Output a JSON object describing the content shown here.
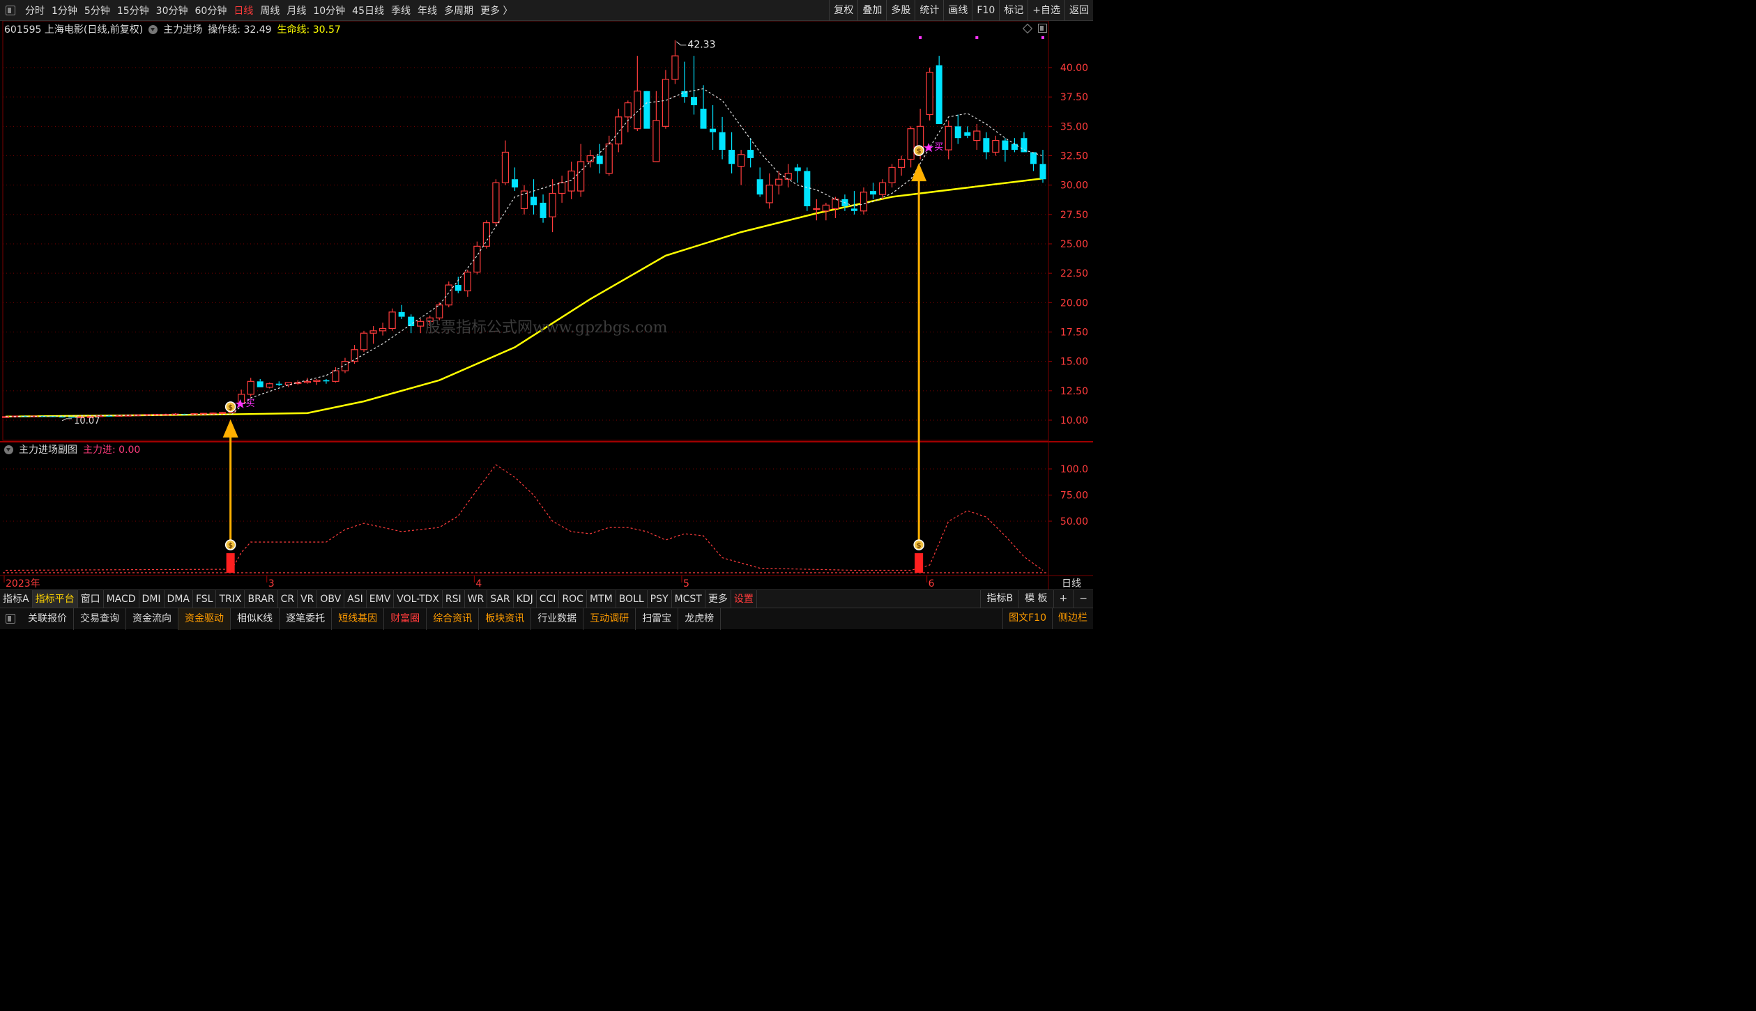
{
  "topbar": {
    "periods": [
      "分时",
      "1分钟",
      "5分钟",
      "15分钟",
      "30分钟",
      "60分钟",
      "日线",
      "周线",
      "月线",
      "10分钟",
      "45日线",
      "季线",
      "年线",
      "多周期",
      "更多 〉"
    ],
    "active_period": "日线",
    "tools": [
      "复权",
      "叠加",
      "多股",
      "统计",
      "画线",
      "F10",
      "标记",
      "+自选",
      "返回"
    ]
  },
  "header": {
    "stock": "601595 上海电影(日线,前复权)",
    "indicator": "主力进场",
    "op_label": "操作线: 32.49",
    "life_label": "生命线: 30.57"
  },
  "watermark": "股票指标公式网www.gpzbgs.com",
  "subchart": {
    "title": "主力进场副图",
    "value_label": "主力进: 0.00"
  },
  "colors": {
    "up": "#ff3c3c",
    "down": "#00e4ff",
    "life": "#ffff00",
    "op": "#e0e0e0",
    "sub": "#ff3c3c",
    "arrow": "#ffb000",
    "grid": "#7a0000"
  },
  "chart_data": {
    "type": "candlestick",
    "price_axis": {
      "min": 10.0,
      "max": 40.0,
      "ticks": [
        "10.00",
        "12.50",
        "15.00",
        "17.50",
        "20.00",
        "22.50",
        "25.00",
        "27.50",
        "30.00",
        "32.50",
        "35.00",
        "37.50",
        "40.00"
      ]
    },
    "sub_axis": {
      "ticks": [
        "50.00",
        "75.00",
        "100.0"
      ]
    },
    "x_labels": [
      "2023年",
      "3",
      "4",
      "5",
      "6"
    ],
    "annotations": {
      "high_label": "42.33",
      "low_label": "10.07",
      "buy_label": "买"
    },
    "period_label": "日线",
    "candles": [
      [
        10.3,
        10.35,
        10.25,
        10.3
      ],
      [
        10.3,
        10.4,
        10.2,
        10.35
      ],
      [
        10.35,
        10.4,
        10.3,
        10.32
      ],
      [
        10.32,
        10.38,
        10.25,
        10.35
      ],
      [
        10.35,
        10.4,
        10.3,
        10.33
      ],
      [
        10.33,
        10.36,
        10.28,
        10.3
      ],
      [
        10.3,
        10.35,
        10.25,
        10.28
      ],
      [
        10.28,
        10.3,
        10.2,
        10.25
      ],
      [
        10.25,
        10.3,
        10.2,
        10.28
      ],
      [
        10.28,
        10.32,
        10.22,
        10.3
      ],
      [
        10.3,
        10.4,
        10.25,
        10.38
      ],
      [
        10.38,
        10.42,
        10.3,
        10.35
      ],
      [
        10.35,
        10.4,
        10.3,
        10.4
      ],
      [
        10.4,
        10.45,
        10.35,
        10.42
      ],
      [
        10.42,
        10.48,
        10.4,
        10.45
      ],
      [
        10.45,
        10.5,
        10.4,
        10.48
      ],
      [
        10.48,
        10.52,
        10.4,
        10.5
      ],
      [
        10.5,
        10.55,
        10.45,
        10.5
      ],
      [
        10.5,
        10.6,
        10.45,
        10.52
      ],
      [
        10.52,
        10.55,
        10.45,
        10.5
      ],
      [
        10.5,
        10.58,
        10.48,
        10.55
      ],
      [
        10.55,
        10.6,
        10.5,
        10.58
      ],
      [
        10.58,
        10.65,
        10.52,
        10.6
      ],
      [
        10.6,
        10.7,
        10.55,
        10.65
      ],
      [
        10.65,
        11.5,
        10.6,
        11.4
      ],
      [
        11.4,
        12.6,
        11.3,
        12.2
      ],
      [
        12.2,
        13.6,
        12.0,
        13.3
      ],
      [
        13.3,
        13.5,
        12.8,
        12.8
      ],
      [
        12.8,
        13.2,
        12.7,
        13.1
      ],
      [
        13.1,
        13.3,
        12.9,
        13.0
      ],
      [
        13.0,
        13.2,
        12.8,
        13.2
      ],
      [
        13.2,
        13.4,
        13.0,
        13.2
      ],
      [
        13.2,
        13.6,
        13.1,
        13.3
      ],
      [
        13.3,
        13.5,
        13.0,
        13.4
      ],
      [
        13.4,
        13.5,
        13.1,
        13.3
      ],
      [
        13.3,
        14.5,
        13.2,
        14.2
      ],
      [
        14.2,
        15.3,
        14.0,
        15.0
      ],
      [
        15.0,
        16.4,
        14.8,
        16.0
      ],
      [
        16.0,
        17.6,
        15.8,
        17.4
      ],
      [
        17.4,
        18.0,
        16.5,
        17.6
      ],
      [
        17.6,
        18.3,
        17.2,
        17.8
      ],
      [
        17.8,
        19.5,
        17.6,
        19.2
      ],
      [
        19.2,
        19.8,
        18.6,
        18.8
      ],
      [
        18.8,
        19.0,
        17.4,
        18.0
      ],
      [
        18.0,
        18.6,
        17.4,
        18.4
      ],
      [
        18.4,
        18.9,
        18.0,
        18.7
      ],
      [
        18.7,
        20.0,
        18.5,
        19.8
      ],
      [
        19.8,
        21.8,
        19.6,
        21.5
      ],
      [
        21.5,
        22.2,
        20.8,
        21.0
      ],
      [
        21.0,
        22.8,
        20.5,
        22.6
      ],
      [
        22.6,
        25.2,
        22.4,
        24.8
      ],
      [
        24.8,
        27.0,
        24.6,
        26.8
      ],
      [
        26.8,
        30.5,
        26.5,
        30.2
      ],
      [
        30.2,
        33.8,
        30.0,
        32.8
      ],
      [
        30.5,
        31.5,
        29.5,
        29.8
      ],
      [
        28.0,
        30.0,
        27.5,
        29.5
      ],
      [
        29.0,
        30.5,
        27.5,
        28.3
      ],
      [
        28.5,
        29.2,
        26.8,
        27.2
      ],
      [
        27.3,
        30.5,
        26.0,
        29.3
      ],
      [
        29.3,
        30.8,
        28.5,
        30.2
      ],
      [
        29.5,
        32.0,
        28.8,
        31.2
      ],
      [
        29.5,
        33.5,
        29.0,
        32.0
      ],
      [
        32.0,
        33.0,
        31.5,
        32.5
      ],
      [
        32.5,
        33.5,
        31.0,
        31.8
      ],
      [
        31.0,
        34.2,
        30.8,
        33.5
      ],
      [
        33.5,
        36.5,
        32.8,
        35.8
      ],
      [
        35.8,
        37.2,
        34.5,
        37.0
      ],
      [
        34.8,
        41.0,
        34.6,
        38.0
      ],
      [
        38.0,
        36.5,
        34.8,
        34.8
      ],
      [
        32.0,
        38.0,
        32.0,
        35.5
      ],
      [
        35.0,
        39.8,
        34.8,
        39.0
      ],
      [
        39.0,
        42.33,
        38.6,
        41.0
      ],
      [
        38.0,
        40.5,
        37.0,
        37.5
      ],
      [
        37.5,
        41.0,
        36.0,
        36.8
      ],
      [
        36.5,
        38.5,
        34.8,
        34.8
      ],
      [
        34.8,
        36.8,
        33.0,
        34.5
      ],
      [
        34.5,
        35.8,
        32.2,
        33.0
      ],
      [
        33.0,
        34.5,
        31.0,
        31.8
      ],
      [
        31.6,
        33.0,
        30.0,
        32.6
      ],
      [
        33.0,
        34.0,
        31.5,
        32.3
      ],
      [
        30.5,
        31.5,
        29.0,
        29.2
      ],
      [
        28.5,
        31.0,
        28.0,
        30.0
      ],
      [
        30.0,
        31.2,
        29.2,
        30.5
      ],
      [
        30.5,
        31.8,
        29.8,
        31.0
      ],
      [
        31.5,
        31.8,
        30.2,
        31.2
      ],
      [
        31.2,
        31.5,
        27.8,
        28.2
      ],
      [
        28.0,
        28.8,
        27.0,
        28.0
      ],
      [
        27.8,
        28.5,
        27.0,
        28.3
      ],
      [
        28.0,
        29.0,
        27.2,
        28.8
      ],
      [
        28.8,
        29.2,
        27.8,
        28.2
      ],
      [
        28.0,
        29.5,
        27.5,
        27.8
      ],
      [
        27.8,
        29.8,
        27.5,
        29.4
      ],
      [
        29.5,
        30.2,
        28.8,
        29.2
      ],
      [
        29.2,
        30.5,
        28.8,
        30.2
      ],
      [
        30.2,
        31.8,
        29.8,
        31.5
      ],
      [
        31.5,
        32.5,
        30.8,
        32.2
      ],
      [
        32.2,
        35.0,
        31.5,
        34.8
      ],
      [
        33.0,
        36.5,
        32.2,
        35.0
      ],
      [
        36.0,
        40.0,
        35.5,
        39.6
      ],
      [
        40.2,
        41.0,
        35.2,
        35.2
      ],
      [
        33.0,
        35.5,
        32.2,
        35.0
      ],
      [
        35.0,
        36.0,
        33.5,
        34.0
      ],
      [
        34.5,
        35.0,
        34.0,
        34.2
      ],
      [
        33.8,
        35.2,
        33.0,
        34.6
      ],
      [
        34.0,
        34.5,
        32.2,
        32.8
      ],
      [
        32.8,
        34.2,
        32.5,
        33.8
      ],
      [
        33.8,
        34.0,
        32.0,
        33.0
      ],
      [
        33.5,
        34.0,
        32.8,
        33.0
      ],
      [
        34.0,
        34.5,
        32.8,
        32.8
      ],
      [
        32.8,
        32.8,
        31.2,
        31.8
      ],
      [
        31.8,
        33.0,
        30.2,
        30.5
      ]
    ],
    "life_line": {
      "points": [
        [
          0,
          10.3
        ],
        [
          24,
          10.5
        ],
        [
          32,
          10.6
        ],
        [
          38,
          11.6
        ],
        [
          46,
          13.4
        ],
        [
          54,
          16.2
        ],
        [
          62,
          20.3
        ],
        [
          70,
          24.0
        ],
        [
          78,
          26.0
        ],
        [
          86,
          27.6
        ],
        [
          94,
          29.0
        ],
        [
          110,
          30.57
        ]
      ]
    },
    "op_line": {
      "points": [
        [
          0,
          10.3
        ],
        [
          24,
          10.5
        ],
        [
          26,
          11.9
        ],
        [
          30,
          13.0
        ],
        [
          34,
          13.8
        ],
        [
          40,
          16.5
        ],
        [
          46,
          19.8
        ],
        [
          50,
          24.0
        ],
        [
          54,
          29.0
        ],
        [
          58,
          30.0
        ],
        [
          60,
          30.4
        ],
        [
          62,
          32.0
        ],
        [
          64,
          33.5
        ],
        [
          66,
          35.5
        ],
        [
          68,
          37.0
        ],
        [
          70,
          37.2
        ],
        [
          72,
          37.9
        ],
        [
          74,
          38.2
        ],
        [
          76,
          37.2
        ],
        [
          78,
          35.0
        ],
        [
          80,
          32.8
        ],
        [
          82,
          31.0
        ],
        [
          84,
          30.0
        ],
        [
          86,
          29.6
        ],
        [
          88,
          28.8
        ],
        [
          90,
          28.2
        ],
        [
          92,
          28.6
        ],
        [
          94,
          29.3
        ],
        [
          96,
          30.5
        ],
        [
          98,
          33.2
        ],
        [
          100,
          35.8
        ],
        [
          102,
          36.1
        ],
        [
          104,
          35.2
        ],
        [
          106,
          34.0
        ],
        [
          108,
          33.0
        ],
        [
          110,
          32.49
        ]
      ]
    },
    "sub_series": {
      "points": [
        [
          0,
          3
        ],
        [
          24,
          4
        ],
        [
          25,
          20
        ],
        [
          26,
          30
        ],
        [
          30,
          30
        ],
        [
          34,
          30
        ],
        [
          36,
          42
        ],
        [
          38,
          48
        ],
        [
          40,
          44
        ],
        [
          42,
          40
        ],
        [
          44,
          42
        ],
        [
          46,
          44
        ],
        [
          48,
          55
        ],
        [
          50,
          80
        ],
        [
          52,
          104
        ],
        [
          54,
          92
        ],
        [
          56,
          75
        ],
        [
          58,
          50
        ],
        [
          60,
          40
        ],
        [
          62,
          38
        ],
        [
          64,
          44
        ],
        [
          66,
          44
        ],
        [
          68,
          40
        ],
        [
          70,
          32
        ],
        [
          72,
          38
        ],
        [
          74,
          36
        ],
        [
          76,
          15
        ],
        [
          78,
          10
        ],
        [
          80,
          5
        ],
        [
          90,
          3
        ],
        [
          96,
          3
        ],
        [
          98,
          8
        ],
        [
          100,
          50
        ],
        [
          102,
          60
        ],
        [
          104,
          54
        ],
        [
          106,
          36
        ],
        [
          108,
          16
        ],
        [
          110,
          3
        ]
      ]
    },
    "buy_signals": [
      {
        "index": 24,
        "price": 10.9
      },
      {
        "index": 97,
        "price": 32.7
      }
    ],
    "magenta_dots": [
      97,
      103,
      110
    ]
  }
}
